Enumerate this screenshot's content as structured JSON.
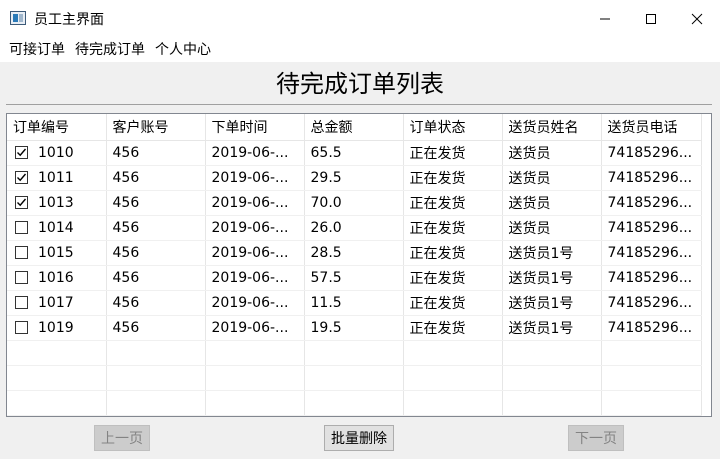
{
  "window": {
    "title": "员工主界面"
  },
  "menu": {
    "items": [
      "可接订单",
      "待完成订单",
      "个人中心"
    ]
  },
  "page": {
    "title": "待完成订单列表"
  },
  "table": {
    "columns": [
      "订单编号",
      "客户账号",
      "下单时间",
      "总金额",
      "订单状态",
      "送货员姓名",
      "送货员电话"
    ],
    "rows": [
      {
        "checked": true,
        "id": "1010",
        "account": "456",
        "time": "2019-06-...",
        "amount": "65.5",
        "status": "正在发货",
        "courier": "送货员",
        "phone": "74185296..."
      },
      {
        "checked": true,
        "id": "1011",
        "account": "456",
        "time": "2019-06-...",
        "amount": "29.5",
        "status": "正在发货",
        "courier": "送货员",
        "phone": "74185296..."
      },
      {
        "checked": true,
        "id": "1013",
        "account": "456",
        "time": "2019-06-...",
        "amount": "70.0",
        "status": "正在发货",
        "courier": "送货员",
        "phone": "74185296..."
      },
      {
        "checked": false,
        "id": "1014",
        "account": "456",
        "time": "2019-06-...",
        "amount": "26.0",
        "status": "正在发货",
        "courier": "送货员",
        "phone": "74185296..."
      },
      {
        "checked": false,
        "id": "1015",
        "account": "456",
        "time": "2019-06-...",
        "amount": "28.5",
        "status": "正在发货",
        "courier": "送货员1号",
        "phone": "74185296..."
      },
      {
        "checked": false,
        "id": "1016",
        "account": "456",
        "time": "2019-06-...",
        "amount": "57.5",
        "status": "正在发货",
        "courier": "送货员1号",
        "phone": "74185296..."
      },
      {
        "checked": false,
        "id": "1017",
        "account": "456",
        "time": "2019-06-...",
        "amount": "11.5",
        "status": "正在发货",
        "courier": "送货员1号",
        "phone": "74185296..."
      },
      {
        "checked": false,
        "id": "1019",
        "account": "456",
        "time": "2019-06-...",
        "amount": "19.5",
        "status": "正在发货",
        "courier": "送货员1号",
        "phone": "74185296..."
      }
    ]
  },
  "footer": {
    "prev_label": "上一页",
    "batch_delete_label": "批量删除",
    "next_label": "下一页"
  }
}
